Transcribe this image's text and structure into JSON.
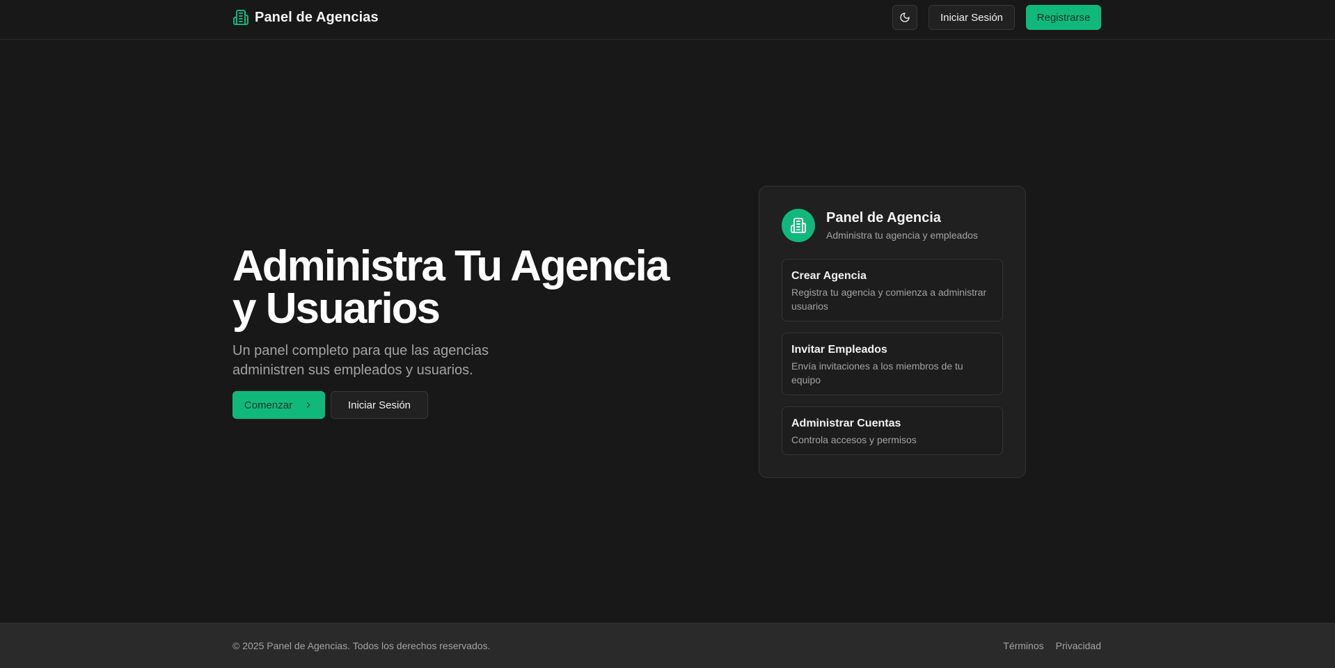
{
  "header": {
    "brand_title": "Panel de Agencias",
    "brand_icon": "building-icon",
    "theme_icon": "moon-icon",
    "login_label": "Iniciar Sesión",
    "register_label": "Registrarse"
  },
  "hero": {
    "title_line1": "Administra Tu Agencia",
    "title_line2": "y Usuarios",
    "subtitle": "Un panel completo para que las agencias administren sus empleados y usuarios.",
    "start_label": "Comenzar",
    "start_icon": "chevron-right-icon",
    "login_label": "Iniciar Sesión"
  },
  "card": {
    "icon": "building-icon",
    "title": "Panel de Agencia",
    "subtitle": "Administra tu agencia y empleados",
    "features": [
      {
        "title": "Crear Agencia",
        "description": "Registra tu agencia y comienza a administrar usuarios"
      },
      {
        "title": "Invitar Empleados",
        "description": "Envía invitaciones a los miembros de tu equipo"
      },
      {
        "title": "Administrar Cuentas",
        "description": "Controla accesos y permisos"
      }
    ]
  },
  "footer": {
    "copyright": "© 2025 Panel de Agencias. Todos los derechos reservados.",
    "links": [
      "Términos",
      "Privacidad"
    ]
  },
  "colors": {
    "accent": "#10b97b",
    "background": "#181818",
    "card": "#202021",
    "footer": "#2a2a2b"
  }
}
